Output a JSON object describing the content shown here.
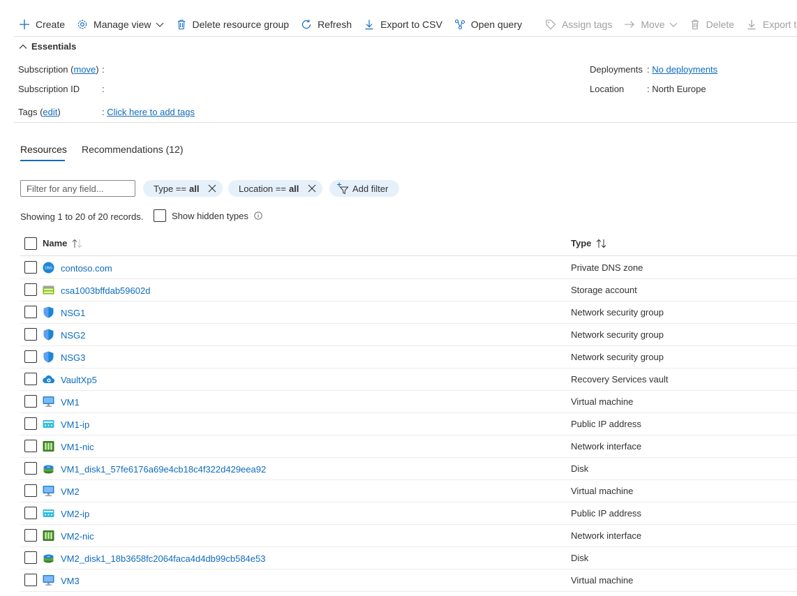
{
  "toolbar": {
    "create": "Create",
    "manage_view": "Manage view",
    "delete_group": "Delete resource group",
    "refresh": "Refresh",
    "export_csv": "Export to CSV",
    "open_query": "Open query",
    "assign_tags": "Assign tags",
    "move": "Move",
    "delete": "Delete",
    "export_template": "Export template"
  },
  "essentials": {
    "title": "Essentials",
    "subscription_label": "Subscription",
    "move_link": "move",
    "subscription_id_label": "Subscription ID",
    "tags_label": "Tags",
    "edit_link": "edit",
    "tags_value": "Click here to add tags",
    "deployments_label": "Deployments",
    "deployments_value": "No deployments",
    "location_label": "Location",
    "location_value": "North Europe"
  },
  "tabs": {
    "resources": "Resources",
    "recommendations": "Recommendations (12)"
  },
  "filters": {
    "placeholder": "Filter for any field...",
    "type_prefix": "Type ==",
    "type_value": "all",
    "location_prefix": "Location ==",
    "location_value": "all",
    "add_filter": "Add filter"
  },
  "records_text": "Showing 1 to 20 of 20 records.",
  "show_hidden": "Show hidden types",
  "table": {
    "col_name": "Name",
    "col_type": "Type",
    "rows": [
      {
        "name": "contoso.com",
        "type": "Private DNS zone",
        "icon": "dns-icon"
      },
      {
        "name": "csa1003bffdab59602d",
        "type": "Storage account",
        "icon": "storage-account-icon"
      },
      {
        "name": "NSG1",
        "type": "Network security group",
        "icon": "nsg-shield-icon"
      },
      {
        "name": "NSG2",
        "type": "Network security group",
        "icon": "nsg-shield-icon"
      },
      {
        "name": "NSG3",
        "type": "Network security group",
        "icon": "nsg-shield-icon"
      },
      {
        "name": "VaultXp5",
        "type": "Recovery Services vault",
        "icon": "recovery-vault-icon"
      },
      {
        "name": "VM1",
        "type": "Virtual machine",
        "icon": "vm-monitor-icon"
      },
      {
        "name": "VM1-ip",
        "type": "Public IP address",
        "icon": "public-ip-icon"
      },
      {
        "name": "VM1-nic",
        "type": "Network interface",
        "icon": "nic-icon"
      },
      {
        "name": "VM1_disk1_57fe6176a69e4cb18c4f322d429eea92",
        "type": "Disk",
        "icon": "disk-icon"
      },
      {
        "name": "VM2",
        "type": "Virtual machine",
        "icon": "vm-monitor-icon"
      },
      {
        "name": "VM2-ip",
        "type": "Public IP address",
        "icon": "public-ip-icon"
      },
      {
        "name": "VM2-nic",
        "type": "Network interface",
        "icon": "nic-icon"
      },
      {
        "name": "VM2_disk1_18b3658fc2064faca4d4db99cb584e53",
        "type": "Disk",
        "icon": "disk-icon"
      },
      {
        "name": "VM3",
        "type": "Virtual machine",
        "icon": "vm-monitor-icon"
      }
    ]
  },
  "colors": {
    "link": "#0f6cbd",
    "pill_bg": "#e5f0fb",
    "disabled": "#a19f9d"
  }
}
